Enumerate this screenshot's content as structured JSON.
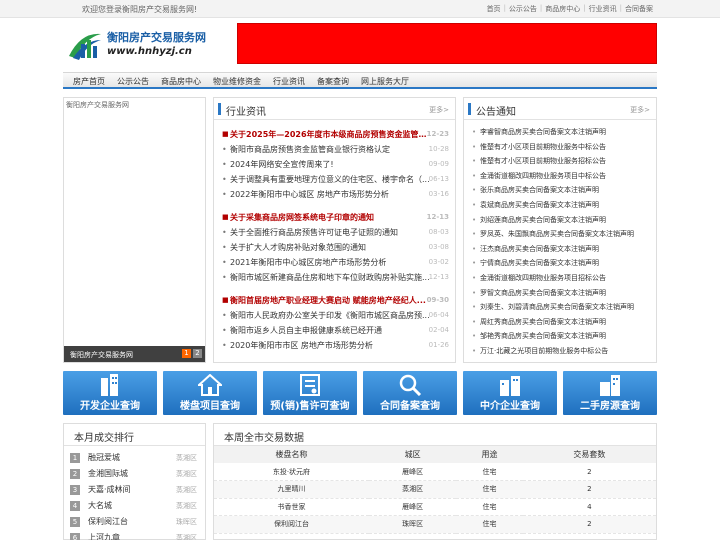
{
  "topbar": {
    "welcome": "欢迎您登录衡阳房产交易服务网!",
    "links": [
      "首页",
      "公示公告",
      "商品房中心",
      "行业资讯",
      "合同备案"
    ]
  },
  "logo": {
    "name": "衡阳房产交易服务网",
    "url": "www.hnhyzj.cn"
  },
  "nav": [
    "房产首页",
    "公示公告",
    "商品房中心",
    "物业维修资金",
    "行业资讯",
    "备案查询",
    "网上服务大厅"
  ],
  "slider": {
    "alt": "衡阳房产交易服务网",
    "caption": "衡阳房产交易服务网",
    "pages": [
      "1",
      "2"
    ]
  },
  "news": {
    "title": "行业资讯",
    "more": "更多>",
    "groups": [
      {
        "headline": {
          "title": "关于2025年—2026年度市本级商品房预售资金监管银...",
          "date": "12-23"
        },
        "items": [
          {
            "title": "衡阳市商品房预售资金监管商业银行资格认定",
            "date": "10-28"
          },
          {
            "title": "2024年网络安全宣传周来了!",
            "date": "09-09"
          },
          {
            "title": "关于调整具有重要地理方位意义的住宅区、楼宇命名（...",
            "date": "06-13"
          },
          {
            "title": "2022年衡阳市中心城区 房地产市场形势分析",
            "date": "03-16"
          }
        ]
      },
      {
        "headline": {
          "title": "关于采集商品房网签系统电子印章的通知",
          "date": "12-13"
        },
        "items": [
          {
            "title": "关于全面推行商品房预售许可证电子证照的通知",
            "date": "08-03"
          },
          {
            "title": "关于扩大人才购房补贴对象范围的通知",
            "date": "03-08"
          },
          {
            "title": "2021年衡阳市中心城区房地产市场形势分析",
            "date": "03-02"
          },
          {
            "title": "衡阳市城区新建商品住房和地下车位财政购房补贴实施...",
            "date": "12-13"
          }
        ]
      },
      {
        "headline": {
          "title": "衡阳首届房地产职业经理大赛启动 赋能房地产经纪人...",
          "date": "09-30"
        },
        "items": [
          {
            "title": "衡阳市人民政府办公室关于印发《衡阳市城区商品房预...",
            "date": "06-04"
          },
          {
            "title": "衡阳市返乡人员自主申报健康系统已经开通",
            "date": "02-04"
          },
          {
            "title": "2020年衡阳市市区 房地产市场形势分析",
            "date": "01-26"
          }
        ]
      }
    ]
  },
  "notice": {
    "title": "公告通知",
    "more": "更多>",
    "items": [
      "李睿智商品房买卖合同备案文本注销声明",
      "惟楚有才小区项目前期物业服务中标公告",
      "惟楚有才小区项目前期物业服务招标公告",
      "金涌街道棚改四期物业服务项目中标公告",
      "张乐商品房买卖合同备案文本注销声明",
      "袁斌商品房买卖合同备案文本注销声明",
      "刘绍莲商品房买卖合同备案文本注销声明",
      "罗凤英、朱国飘商品房买卖合同备案文本注销声明",
      "汪杰商品房买卖合同备案文本注销声明",
      "宁倩商品房买卖合同备案文本注销声明",
      "金涌街道棚改四期物业服务项目招标公告",
      "罗智文商品房买卖合同备案文本注销声明",
      "刘秦生、刘碧清商品房买卖合同备案文本注销声明",
      "周红秀商品房买卖合同备案文本注销声明",
      "邹艳秀商品房买卖合同备案文本注销声明",
      "万江·北藏之光项目前期物业服务中标公告"
    ]
  },
  "quick": [
    {
      "label": "开发企业查询",
      "icon": "building-icon"
    },
    {
      "label": "楼盘项目查询",
      "icon": "house-icon"
    },
    {
      "label": "预(销)售许可查询",
      "icon": "certificate-icon"
    },
    {
      "label": "合同备案查询",
      "icon": "search-icon"
    },
    {
      "label": "中介企业查询",
      "icon": "office-icon"
    },
    {
      "label": "二手房源查询",
      "icon": "secondhand-icon"
    }
  ],
  "rank": {
    "title": "本月成交排行",
    "items": [
      {
        "n": "1",
        "name": "融冠爱城",
        "area": "蒸湘区"
      },
      {
        "n": "2",
        "name": "金湘国际城",
        "area": "蒸湘区"
      },
      {
        "n": "3",
        "name": "天嘉·成林间",
        "area": "蒸湘区"
      },
      {
        "n": "4",
        "name": "大名城",
        "area": "蒸湘区"
      },
      {
        "n": "5",
        "name": "保利阅江台",
        "area": "珠晖区"
      },
      {
        "n": "6",
        "name": "上河九章",
        "area": "蒸湘区"
      }
    ]
  },
  "weekly": {
    "title": "本周全市交易数据",
    "columns": [
      "楼盘名称",
      "城区",
      "用途",
      "交易套数"
    ],
    "rows": [
      [
        "东投·状元府",
        "雁峰区",
        "住宅",
        "2"
      ],
      [
        "九里晴川",
        "蒸湘区",
        "住宅",
        "2"
      ],
      [
        "书香世家",
        "雁峰区",
        "住宅",
        "4"
      ],
      [
        "保利阅江台",
        "珠晖区",
        "住宅",
        "2"
      ]
    ]
  },
  "colors": {
    "accent": "#2b78c5",
    "headline": "#b20000",
    "banner": "#ff0000"
  }
}
